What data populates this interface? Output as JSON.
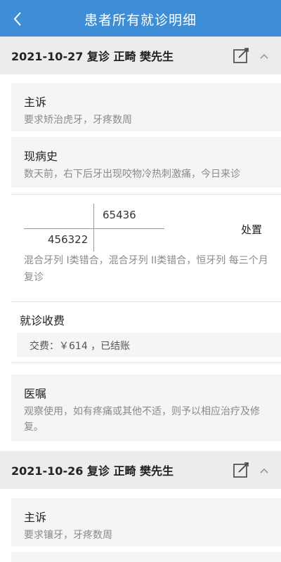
{
  "header": {
    "title": "患者所有就诊明细",
    "back_icon": "chevron-left-icon"
  },
  "visits": [
    {
      "title": "2021-10-27 复诊 正畸 樊先生",
      "edit_icon": "edit-icon",
      "collapse_icon": "chevron-up-icon",
      "complaint": {
        "label": "主诉",
        "text": "要求矫治虎牙，牙疼数周"
      },
      "history": {
        "label": "现病史",
        "text": "数天前，右下后牙出现咬物冷热刺激痛，今日来诊"
      },
      "tooth_chart": {
        "upper_right": "65436",
        "lower_left": "456322",
        "treatment_label": "处置"
      },
      "diagnosis": "混合牙列 I类错合，混合牙列 II类错合，恒牙列 每三个月复诊",
      "fee": {
        "label": "就诊收费",
        "text": "交费：￥614 ，已结账"
      },
      "advice": {
        "label": "医嘱",
        "text": "观察使用，如有疼痛或其他不适，则予以相应治疗及修复。"
      }
    },
    {
      "title": "2021-10-26 复诊 正畸 樊先生",
      "edit_icon": "edit-icon",
      "collapse_icon": "chevron-up-icon",
      "complaint": {
        "label": "主诉",
        "text": "要求镶牙，牙疼数周"
      }
    }
  ]
}
